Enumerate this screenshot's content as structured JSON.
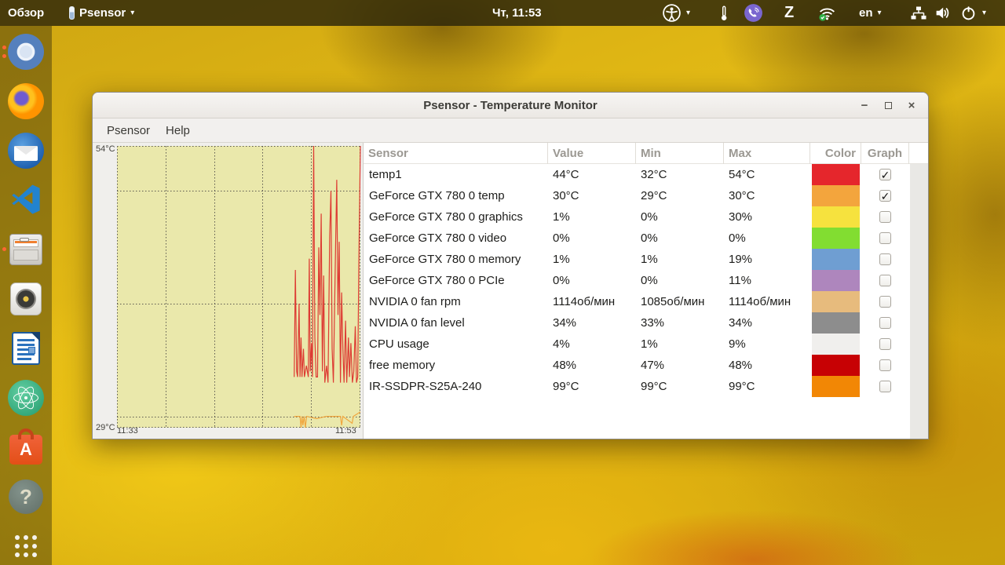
{
  "topbar": {
    "activities_label": "Обзор",
    "app_menu_label": "Psensor",
    "clock": "Чт, 11:53",
    "language_label": "en",
    "status_icons": [
      "accessibility",
      "thermometer",
      "viber",
      "zoiper",
      "network-wifi",
      "keyboard-layout",
      "network-wired",
      "volume",
      "power"
    ]
  },
  "dock": {
    "items": [
      "chromium",
      "firefox",
      "thunderbird",
      "vscode",
      "file-cabinet",
      "audio-player",
      "libreoffice-writer",
      "atom",
      "ubuntu-software",
      "help",
      "app-grid"
    ]
  },
  "window": {
    "titlebar": {
      "title": "Psensor - Temperature Monitor",
      "minimize_glyph": "−",
      "close_glyph": "×"
    },
    "menubar": {
      "items": [
        "Psensor",
        "Help"
      ]
    },
    "graph": {
      "y_max_label": "54°C",
      "y_min_label": "29°C",
      "x_start_label": "11:33",
      "x_end_label": "11:53",
      "y_range": [
        29,
        54
      ],
      "gridline_temps": [
        50,
        40,
        30
      ],
      "series": [
        {
          "name": "temp1",
          "color": "#dd3b33",
          "points": [
            [
              0.728,
              33.5
            ],
            [
              0.733,
              43
            ],
            [
              0.738,
              34
            ],
            [
              0.742,
              33.5
            ],
            [
              0.748,
              40
            ],
            [
              0.752,
              33.5
            ],
            [
              0.756,
              37
            ],
            [
              0.76,
              33.5
            ],
            [
              0.766,
              36
            ],
            [
              0.77,
              33.5
            ],
            [
              0.778,
              34.5
            ],
            [
              0.786,
              33.5
            ],
            [
              0.79,
              44
            ],
            [
              0.794,
              34
            ],
            [
              0.799,
              36.5
            ],
            [
              0.803,
              33.5
            ],
            [
              0.808,
              54
            ],
            [
              0.813,
              37
            ],
            [
              0.818,
              33.5
            ],
            [
              0.824,
              33.5
            ],
            [
              0.829,
              45
            ],
            [
              0.834,
              39
            ],
            [
              0.839,
              48
            ],
            [
              0.844,
              34
            ],
            [
              0.849,
              42.5
            ],
            [
              0.854,
              33
            ],
            [
              0.861,
              34.5
            ],
            [
              0.867,
              33
            ],
            [
              0.874,
              46
            ],
            [
              0.879,
              50
            ],
            [
              0.884,
              36
            ],
            [
              0.889,
              33
            ],
            [
              0.898,
              45
            ],
            [
              0.903,
              51
            ],
            [
              0.908,
              39
            ],
            [
              0.913,
              45.5
            ],
            [
              0.918,
              33
            ],
            [
              0.923,
              41
            ],
            [
              0.928,
              36
            ],
            [
              0.933,
              33
            ],
            [
              0.939,
              38.5
            ],
            [
              0.944,
              33
            ],
            [
              0.951,
              37
            ],
            [
              0.955,
              33.5
            ],
            [
              0.961,
              36.5
            ],
            [
              0.967,
              33
            ],
            [
              0.973,
              34
            ],
            [
              0.979,
              38
            ],
            [
              0.984,
              33
            ],
            [
              0.989,
              33.5
            ],
            [
              0.994,
              44
            ],
            [
              1.0,
              54
            ]
          ]
        },
        {
          "name": "GeForce GTX 780 0 temp",
          "color": "#f0a63e",
          "points": [
            [
              0.728,
              30
            ],
            [
              0.752,
              30
            ],
            [
              0.756,
              29
            ],
            [
              0.76,
              30
            ],
            [
              0.764,
              29.2
            ],
            [
              0.769,
              30
            ],
            [
              0.774,
              29
            ],
            [
              0.779,
              30
            ],
            [
              0.82,
              29.8
            ],
            [
              0.86,
              30
            ],
            [
              0.918,
              30
            ],
            [
              0.923,
              29.2
            ],
            [
              0.928,
              30
            ],
            [
              0.966,
              29.4
            ],
            [
              0.971,
              30
            ],
            [
              1.0,
              30.4
            ]
          ]
        }
      ]
    },
    "table": {
      "headers": [
        "Sensor",
        "Value",
        "Min",
        "Max",
        "Color",
        "Graph"
      ],
      "check_glyph": "✓",
      "rows": [
        {
          "sensor": "temp1",
          "value": "44°C",
          "min": "32°C",
          "max": "54°C",
          "color": "#e5262c",
          "graph_enabled": true
        },
        {
          "sensor": "GeForce GTX 780 0 temp",
          "value": "30°C",
          "min": "29°C",
          "max": "30°C",
          "color": "#f3a53d",
          "graph_enabled": true
        },
        {
          "sensor": "GeForce GTX 780 0 graphics",
          "value": "1%",
          "min": "0%",
          "max": "30%",
          "color": "#f6e23e",
          "graph_enabled": false
        },
        {
          "sensor": "GeForce GTX 780 0 video",
          "value": "0%",
          "min": "0%",
          "max": "0%",
          "color": "#82dd31",
          "graph_enabled": false
        },
        {
          "sensor": "GeForce GTX 780 0 memory",
          "value": "1%",
          "min": "1%",
          "max": "19%",
          "color": "#6f9ed2",
          "graph_enabled": false
        },
        {
          "sensor": "GeForce GTX 780 0 PCIe",
          "value": "0%",
          "min": "0%",
          "max": "11%",
          "color": "#ae86bd",
          "graph_enabled": false
        },
        {
          "sensor": "NVIDIA 0 fan rpm",
          "value": "1114об/мин",
          "min": "1085об/мин",
          "max": "1114об/мин",
          "color": "#e7bb7d",
          "graph_enabled": false
        },
        {
          "sensor": "NVIDIA 0 fan level",
          "value": "34%",
          "min": "33%",
          "max": "34%",
          "color": "#8d8d8d",
          "graph_enabled": false
        },
        {
          "sensor": "CPU usage",
          "value": "4%",
          "min": "1%",
          "max": "9%",
          "color": "#f0efed",
          "graph_enabled": false
        },
        {
          "sensor": "free memory",
          "value": "48%",
          "min": "47%",
          "max": "48%",
          "color": "#c70104",
          "graph_enabled": false
        },
        {
          "sensor": "IR-SSDPR-S25A-240",
          "value": "99°C",
          "min": "99°C",
          "max": "99°C",
          "color": "#f28705",
          "graph_enabled": false
        }
      ]
    }
  }
}
